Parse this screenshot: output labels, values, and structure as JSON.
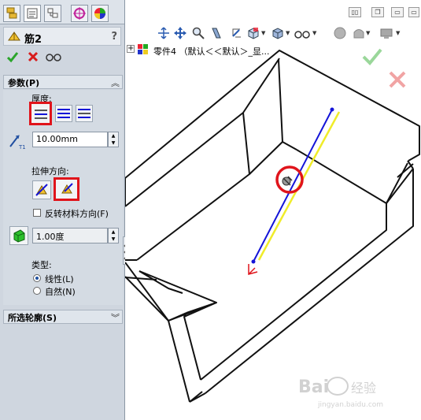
{
  "tabs": [
    {
      "name": "featuremanager-tab",
      "icon": "feature-tree-icon"
    },
    {
      "name": "propertymanager-tab",
      "icon": "property-sheet-icon"
    },
    {
      "name": "configuration-tab",
      "icon": "configuration-icon"
    },
    {
      "name": "dimxpert-tab",
      "icon": "crosshair-icon"
    },
    {
      "name": "display-tab",
      "icon": "color-wheel-icon"
    }
  ],
  "feature": {
    "title": "筋2",
    "help": "?"
  },
  "params": {
    "group_title": "参数(P)",
    "thickness_label": "厚度:",
    "thickness_value": "10.00mm",
    "extrude_dir_label": "拉伸方向:",
    "flip_label": "反转材料方向(F)",
    "draft_value": "1.00度",
    "type_label": "类型:",
    "type_options": [
      {
        "label": "线性(L)",
        "selected": true
      },
      {
        "label": "自然(N)",
        "selected": false
      }
    ]
  },
  "profile_group": {
    "title": "所选轮廓(S)"
  },
  "tree": {
    "item": "零件4 （默认＜＜默认＞_显..."
  },
  "watermark": {
    "brand": "Bai",
    "brand2": "经验",
    "url": "jingyan.baidu.com"
  },
  "colors": {
    "accept": "#2aa52a",
    "cancel": "#d81c1c",
    "highlight": "#e0141b",
    "rib_blue": "#1414d8",
    "rib_yellow": "#f0ec2a"
  }
}
